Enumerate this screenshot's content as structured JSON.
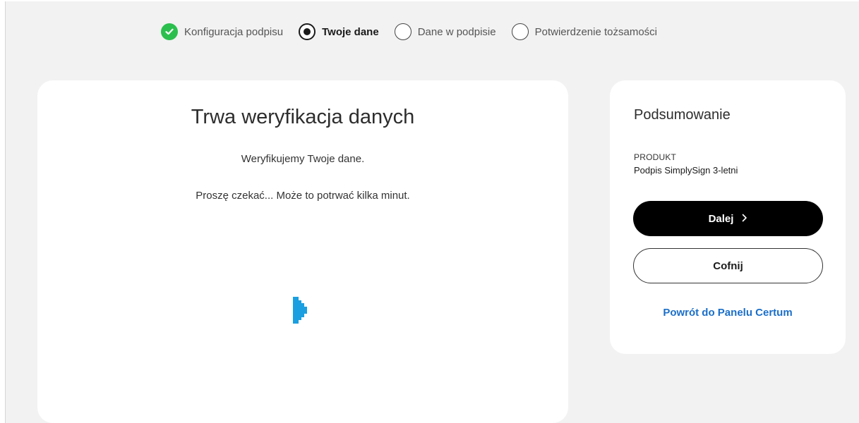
{
  "stepper": {
    "steps": [
      {
        "label": "Konfiguracja podpisu",
        "state": "done"
      },
      {
        "label": "Twoje dane",
        "state": "current"
      },
      {
        "label": "Dane w podpisie",
        "state": "pending"
      },
      {
        "label": "Potwierdzenie tożsamości",
        "state": "pending"
      }
    ]
  },
  "main": {
    "title": "Trwa weryfikacja danych",
    "line1": "Weryfikujemy Twoje dane.",
    "line2": "Proszę czekać... Może to potrwać kilka minut.",
    "spinner_icon": "loading-spinner-icon"
  },
  "summary": {
    "title": "Podsumowanie",
    "product_label": "PRODUKT",
    "product_name": "Podpis SimplySign 3-letni",
    "next_label": "Dalej",
    "next_icon": "chevron-right-icon",
    "back_label": "Cofnij",
    "panel_link": "Powrót do Panelu Certum"
  },
  "colors": {
    "background": "#f2f2f2",
    "done_green": "#2bbf4e",
    "link_blue": "#1b6fc9",
    "spinner_blue": "#1a9fe0",
    "primary_button": "#000000"
  }
}
